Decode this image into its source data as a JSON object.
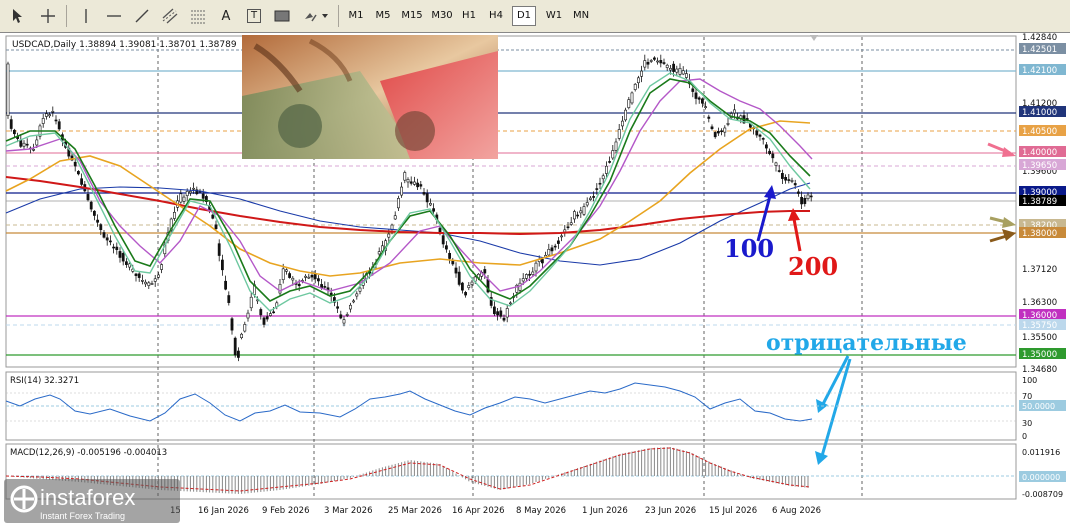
{
  "toolbar": {
    "tools": [
      "cursor-icon",
      "crosshair-icon",
      "vertical-line-icon",
      "horizontal-line-icon",
      "trendline-icon",
      "channel-icon",
      "fibonacci-icon",
      "text-icon",
      "label-icon",
      "rectangle-icon",
      "shapes-icon"
    ],
    "text_tool_label": "A",
    "label_tool_label": "T",
    "timeframes": [
      "M1",
      "M5",
      "M15",
      "M30",
      "H1",
      "H4",
      "D1",
      "W1",
      "MN"
    ],
    "active_timeframe": "D1"
  },
  "main": {
    "symbol_info": "USDCAD,Daily  1.38894 1.39081 1.38701 1.38789",
    "price_ticks": [
      "1.42840",
      "1.41200",
      "1.39600",
      "1.37120",
      "1.36300",
      "1.35500",
      "1.34680"
    ],
    "level_labels": [
      {
        "value": "1.42501",
        "bg": "#7b8fa3"
      },
      {
        "value": "1.42100",
        "bg": "#7fb7d1"
      },
      {
        "value": "1.41000",
        "bg": "#20347a"
      },
      {
        "value": "1.40500",
        "bg": "#e8a246"
      },
      {
        "value": "1.40000",
        "bg": "#e06b94"
      },
      {
        "value": "1.39650",
        "bg": "#d8a7d6"
      },
      {
        "value": "1.39000",
        "bg": "#0a1a8a"
      },
      {
        "value": "1.38789",
        "bg": "#000000"
      },
      {
        "value": "1.38200",
        "bg": "#c8b890"
      },
      {
        "value": "1.38000",
        "bg": "#c88a3a"
      },
      {
        "value": "1.36000",
        "bg": "#c030c0"
      },
      {
        "value": "1.35750",
        "bg": "#bcd8ec"
      },
      {
        "value": "1.35000",
        "bg": "#2e9a2e"
      }
    ],
    "annotation_100": "100",
    "annotation_200": "200",
    "annotation_negative": "отрицательные",
    "ma_colors": {
      "ma100": "#1a3aa8",
      "ma200": "#d01818",
      "gold": "#e8a420",
      "purple": "#b458c8",
      "green_dark": "#1a7a1a",
      "green_light": "#6ec8a0"
    }
  },
  "rsi": {
    "label": "RSI(14) 32.3271",
    "ticks": [
      "100",
      "70",
      "50.0000",
      "30",
      "0"
    ]
  },
  "macd": {
    "label": "MACD(12,26,9) -0.005196 -0.004013",
    "ticks": [
      "0.011916",
      "0.000000",
      "-0.008709"
    ]
  },
  "x_axis": {
    "dates": [
      "15",
      "16 Jan 2026",
      "9 Feb 2026",
      "3 Mar 2026",
      "25 Mar 2026",
      "16 Apr 2026",
      "8 May 2026",
      "1 Jun 2026",
      "23 Jun 2026",
      "15 Jul 2026",
      "6 Aug 2026"
    ]
  },
  "brand": {
    "name": "instaforex",
    "tagline": "Instant Forex Trading"
  }
}
